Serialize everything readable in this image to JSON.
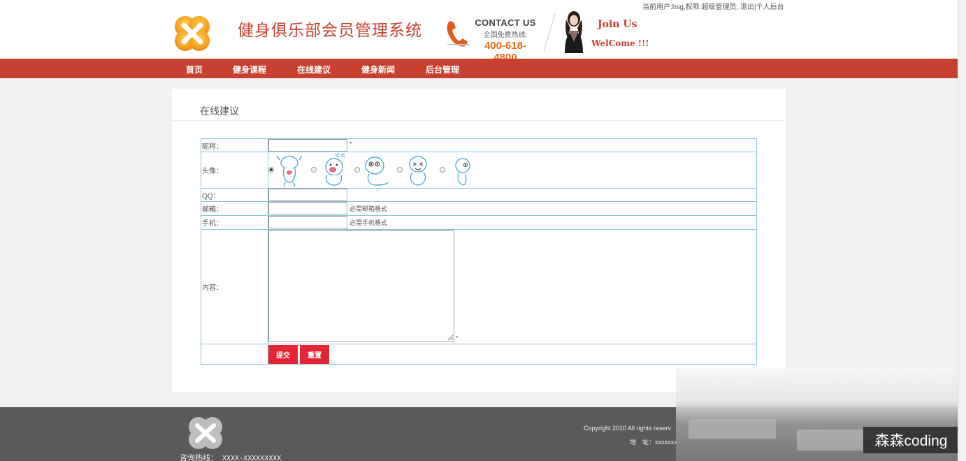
{
  "header": {
    "user_info": "当前用户:hsg,权限:超级管理员; 退出|个人后台",
    "site_title": "健身俱乐部会员管理系统",
    "contact_title": "CONTACT US",
    "contact_sub": "全国免费热线:",
    "contact_phone": "400-618-4800",
    "join_line1": "Join Us",
    "join_line2": "WelCome !!!"
  },
  "nav": {
    "items": [
      {
        "label": "首页"
      },
      {
        "label": "健身课程"
      },
      {
        "label": "在线建议"
      },
      {
        "label": "健身新闻"
      },
      {
        "label": "后台管理"
      }
    ]
  },
  "panel": {
    "title": "在线建议"
  },
  "form": {
    "nickname_label": "昵称：",
    "nickname_required": "*",
    "avatar_label": "头像：",
    "avatar_selected_index": 0,
    "avatar_count": 5,
    "avatar_caption": "哈 哈",
    "qq_label": "QQ：",
    "email_label": "邮箱：",
    "email_hint": "必需邮箱格式",
    "phone_label": "手机：",
    "phone_hint": "必需手机格式",
    "content_label": "内容：",
    "content_required": "*",
    "submit_label": "提交",
    "reset_label": "重置"
  },
  "footer": {
    "hotline_label": "咨询热线：",
    "hotline_value": "XXXX-XXXXXXXXX",
    "copyright": "Copyright 2010 All rights reserv",
    "address": "地　址：xxxxxxx"
  },
  "watermark": "森森coding",
  "colors": {
    "brand_red": "#c8412e",
    "button_red": "#e42535",
    "phone_orange": "#e86a16",
    "table_border": "#8fc3dd",
    "footer_bg": "#5a5a5a"
  }
}
